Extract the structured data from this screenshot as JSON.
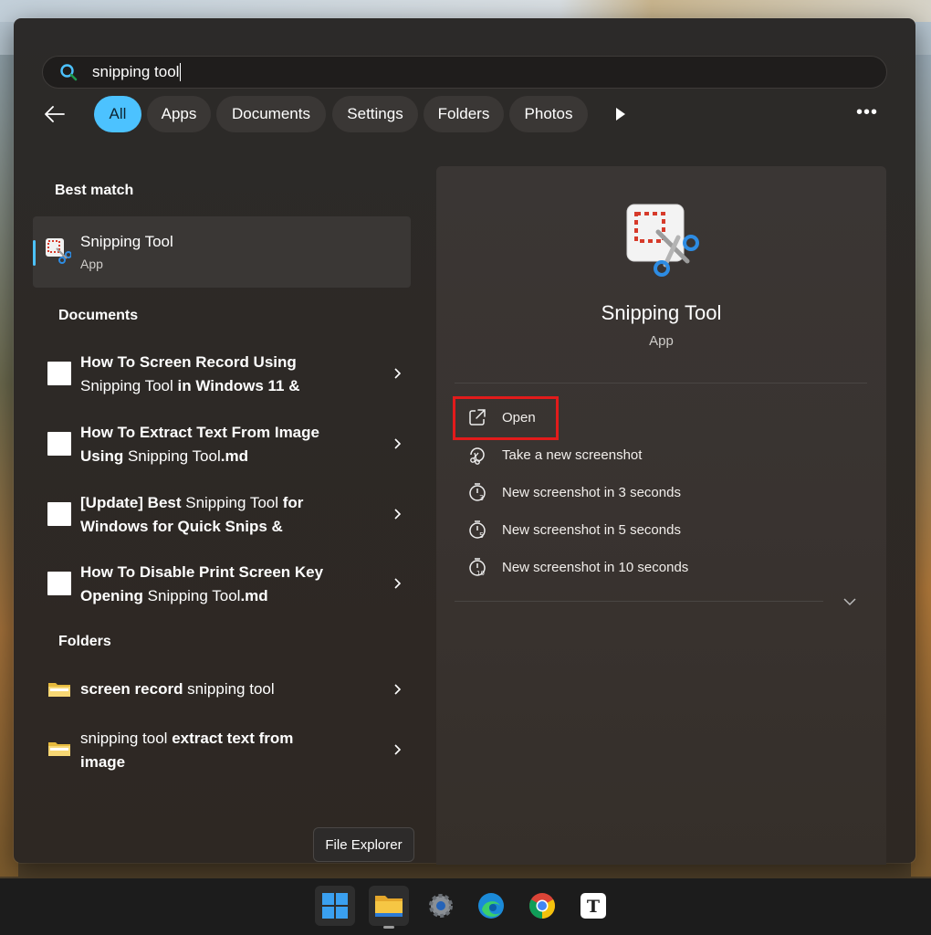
{
  "search": {
    "query": "snipping tool"
  },
  "filters": {
    "chips": [
      "All",
      "Apps",
      "Documents",
      "Settings",
      "Folders",
      "Photos"
    ],
    "active": "All"
  },
  "best_match": {
    "heading": "Best match",
    "name": "Snipping Tool",
    "type": "App"
  },
  "documents": {
    "heading": "Documents",
    "items": [
      {
        "bold1": "How To Screen Record Using",
        "line2a": "Snipping Tool",
        "line2b": " in Windows 11 &"
      },
      {
        "bold1": "How To Extract Text From Image",
        "line2a": "Using",
        "line2b": " Snipping Tool",
        "line2c": ".md"
      },
      {
        "bold1": "[Update] Best",
        "bold1b": " Snipping Tool ",
        "bold1c": "for",
        "line2a": "Windows for Quick Snips &"
      },
      {
        "bold1": "How To Disable Print Screen Key",
        "line2a": "Opening",
        "line2b": " Snipping Tool",
        "line2c": ".md"
      }
    ]
  },
  "folders": {
    "heading": "Folders",
    "items": [
      {
        "a": "screen record",
        "b": " snipping tool"
      },
      {
        "a": "snipping tool",
        "b": " extract text from",
        "c": "image"
      }
    ]
  },
  "details": {
    "name": "Snipping Tool",
    "type": "App",
    "actions": [
      {
        "label": "Open",
        "icon": "open-external-icon"
      },
      {
        "label": "Take a new screenshot",
        "icon": "snip-icon"
      },
      {
        "label": "New screenshot in 3 seconds",
        "icon": "timer-3-icon"
      },
      {
        "label": "New screenshot in 5 seconds",
        "icon": "timer-5-icon"
      },
      {
        "label": "New screenshot in 10 seconds",
        "icon": "timer-10-icon"
      }
    ]
  },
  "tooltip": "File Explorer",
  "taskbar": [
    "windows-start-icon",
    "file-explorer-icon",
    "settings-icon",
    "edge-icon",
    "chrome-icon",
    "typora-icon"
  ],
  "colors": {
    "accent": "#4cc2ff",
    "highlight": "#e21b1b"
  }
}
